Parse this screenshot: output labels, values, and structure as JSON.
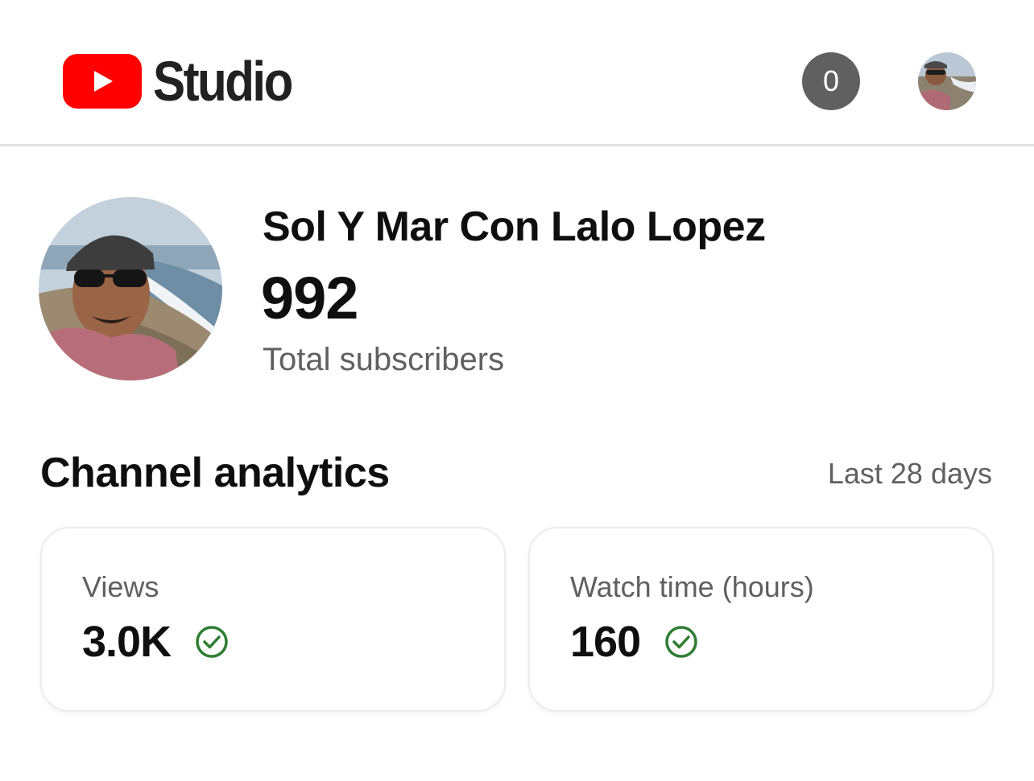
{
  "header": {
    "logo_text": "Studio",
    "notification_count": "0",
    "brand_color": "#FF0000"
  },
  "channel": {
    "name": "Sol Y Mar Con Lalo Lopez",
    "subscriber_count": "992",
    "subscriber_label": "Total subscribers"
  },
  "analytics": {
    "title": "Channel analytics",
    "range": "Last 28 days",
    "cards": [
      {
        "label": "Views",
        "value": "3.0K",
        "status_icon": "check-circle-icon",
        "status_color": "#2E7D32"
      },
      {
        "label": "Watch time (hours)",
        "value": "160",
        "status_icon": "check-circle-icon",
        "status_color": "#2E7D32"
      }
    ]
  }
}
